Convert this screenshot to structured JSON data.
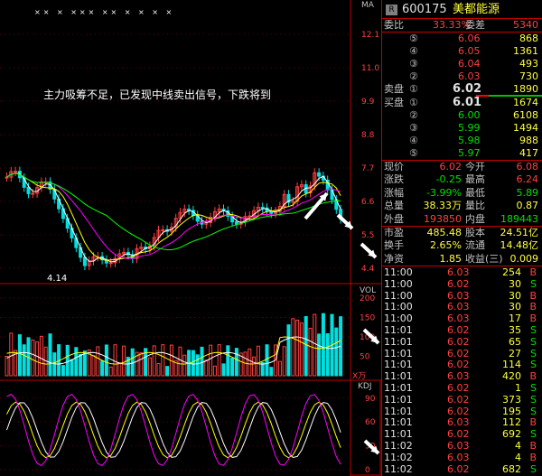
{
  "stock": {
    "badge": "R",
    "code": "600175",
    "name": "美都能源"
  },
  "header_weibi": {
    "label": "委比",
    "pct": "33.33%",
    "diff_label": "委差",
    "diff": "5340"
  },
  "sell_levels": [
    {
      "idx": "⑤",
      "price": "6.06",
      "vol": "868"
    },
    {
      "idx": "④",
      "price": "6.05",
      "vol": "1361"
    },
    {
      "idx": "③",
      "price": "6.04",
      "vol": "493"
    },
    {
      "idx": "②",
      "price": "6.03",
      "vol": "730"
    },
    {
      "idx": "①",
      "price": "6.02",
      "vol": "1890"
    }
  ],
  "buy_levels": [
    {
      "idx": "①",
      "price": "6.01",
      "vol": "1674"
    },
    {
      "idx": "②",
      "price": "6.00",
      "vol": "6108"
    },
    {
      "idx": "③",
      "price": "5.99",
      "vol": "1494"
    },
    {
      "idx": "④",
      "price": "5.98",
      "vol": "988"
    },
    {
      "idx": "⑤",
      "price": "5.97",
      "vol": "417"
    }
  ],
  "sell_label": "卖盘",
  "buy_label": "买盘",
  "quote": [
    {
      "l1": "现价",
      "v1": "6.02",
      "l2": "今开",
      "v2": "6.08",
      "c1": "red",
      "c2": "red"
    },
    {
      "l1": "涨跌",
      "v1": "-0.25",
      "l2": "最高",
      "v2": "6.24",
      "c1": "green",
      "c2": "red"
    },
    {
      "l1": "涨幅",
      "v1": "-3.99%",
      "l2": "最低",
      "v2": "5.89",
      "c1": "green",
      "c2": "green"
    },
    {
      "l1": "总量",
      "v1": "38.33万",
      "l2": "量比",
      "v2": "0.87",
      "c1": "yellow",
      "c2": "yellow"
    },
    {
      "l1": "外盘",
      "v1": "193850",
      "l2": "内盘",
      "v2": "189443",
      "c1": "red",
      "c2": "green"
    }
  ],
  "fundamentals": [
    {
      "l1": "市盈",
      "v1": "485.48",
      "l2": "股本",
      "v2": "24.51亿"
    },
    {
      "l1": "换手",
      "v1": "2.65%",
      "l2": "流通",
      "v2": "14.48亿"
    },
    {
      "l1": "净资",
      "v1": "1.85",
      "l2": "收益(三)",
      "v2": "0.009"
    }
  ],
  "ticks": [
    {
      "t": "11:00",
      "p": "6.03",
      "v": "254",
      "d": "B"
    },
    {
      "t": "11:00",
      "p": "6.02",
      "v": "30",
      "d": "S"
    },
    {
      "t": "11:00",
      "p": "6.03",
      "v": "30",
      "d": "B"
    },
    {
      "t": "11:00",
      "p": "6.03",
      "v": "30",
      "d": "B"
    },
    {
      "t": "11:00",
      "p": "6.03",
      "v": "17",
      "d": "B"
    },
    {
      "t": "11:01",
      "p": "6.02",
      "v": "35",
      "d": "S"
    },
    {
      "t": "11:01",
      "p": "6.02",
      "v": "65",
      "d": "S"
    },
    {
      "t": "11:01",
      "p": "6.02",
      "v": "27",
      "d": "S"
    },
    {
      "t": "11:01",
      "p": "6.02",
      "v": "114",
      "d": "S"
    },
    {
      "t": "11:01",
      "p": "6.03",
      "v": "420",
      "d": "B"
    },
    {
      "t": "11:01",
      "p": "6.02",
      "v": "1",
      "d": "S"
    },
    {
      "t": "11:01",
      "p": "6.02",
      "v": "373",
      "d": "S"
    },
    {
      "t": "11:01",
      "p": "6.02",
      "v": "195",
      "d": "S"
    },
    {
      "t": "11:01",
      "p": "6.03",
      "v": "112",
      "d": "B"
    },
    {
      "t": "11:01",
      "p": "6.02",
      "v": "692",
      "d": "S"
    },
    {
      "t": "11:02",
      "p": "6.03",
      "v": "4",
      "d": "B"
    },
    {
      "t": "11:02",
      "p": "6.03",
      "v": "4",
      "d": "B"
    },
    {
      "t": "11:02",
      "p": "6.02",
      "v": "682",
      "d": "S"
    }
  ],
  "chart": {
    "top_marks": "×× × ××× ×× × × × ×",
    "ma_label": "MA",
    "price_axis": [
      "12.1",
      "11.0",
      "9.9",
      "8.8",
      "7.7",
      "6.6",
      "5.5",
      "4.4"
    ],
    "low_label": "4.14",
    "annotation": "主力吸筹不足，已发现中线卖出信号，下跌将到",
    "vol_label": "VOL",
    "vol_axis": [
      "200",
      "150",
      "100",
      "50"
    ],
    "vol_unit": "X万",
    "kdj_label": "KDJ",
    "kdj_axis": [
      "90",
      "60",
      "30",
      "0"
    ]
  },
  "colors": {
    "up": "#ff4040",
    "down": "#00e0e0",
    "ma1": "#ffffff",
    "ma2": "#ffff00",
    "ma3": "#ff00ff",
    "ma4": "#00ff00"
  }
}
